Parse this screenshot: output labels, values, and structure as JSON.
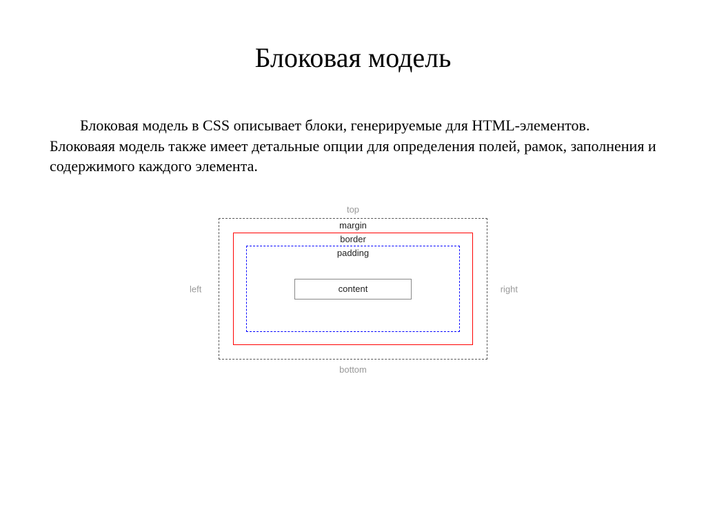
{
  "title": "Блоковая модель",
  "paragraph": "Блоковая модель в CSS описывает блоки, генерируемые для HTML-элементов. Блоковаяя модель также имеет детальные опции для определения полей, рамок, заполнения и содержимого каждого элемента.",
  "diagram": {
    "outer": {
      "top": "top",
      "bottom": "bottom",
      "left": "left",
      "right": "right"
    },
    "margin": "margin",
    "border": "border",
    "padding": "padding",
    "content": "content"
  }
}
